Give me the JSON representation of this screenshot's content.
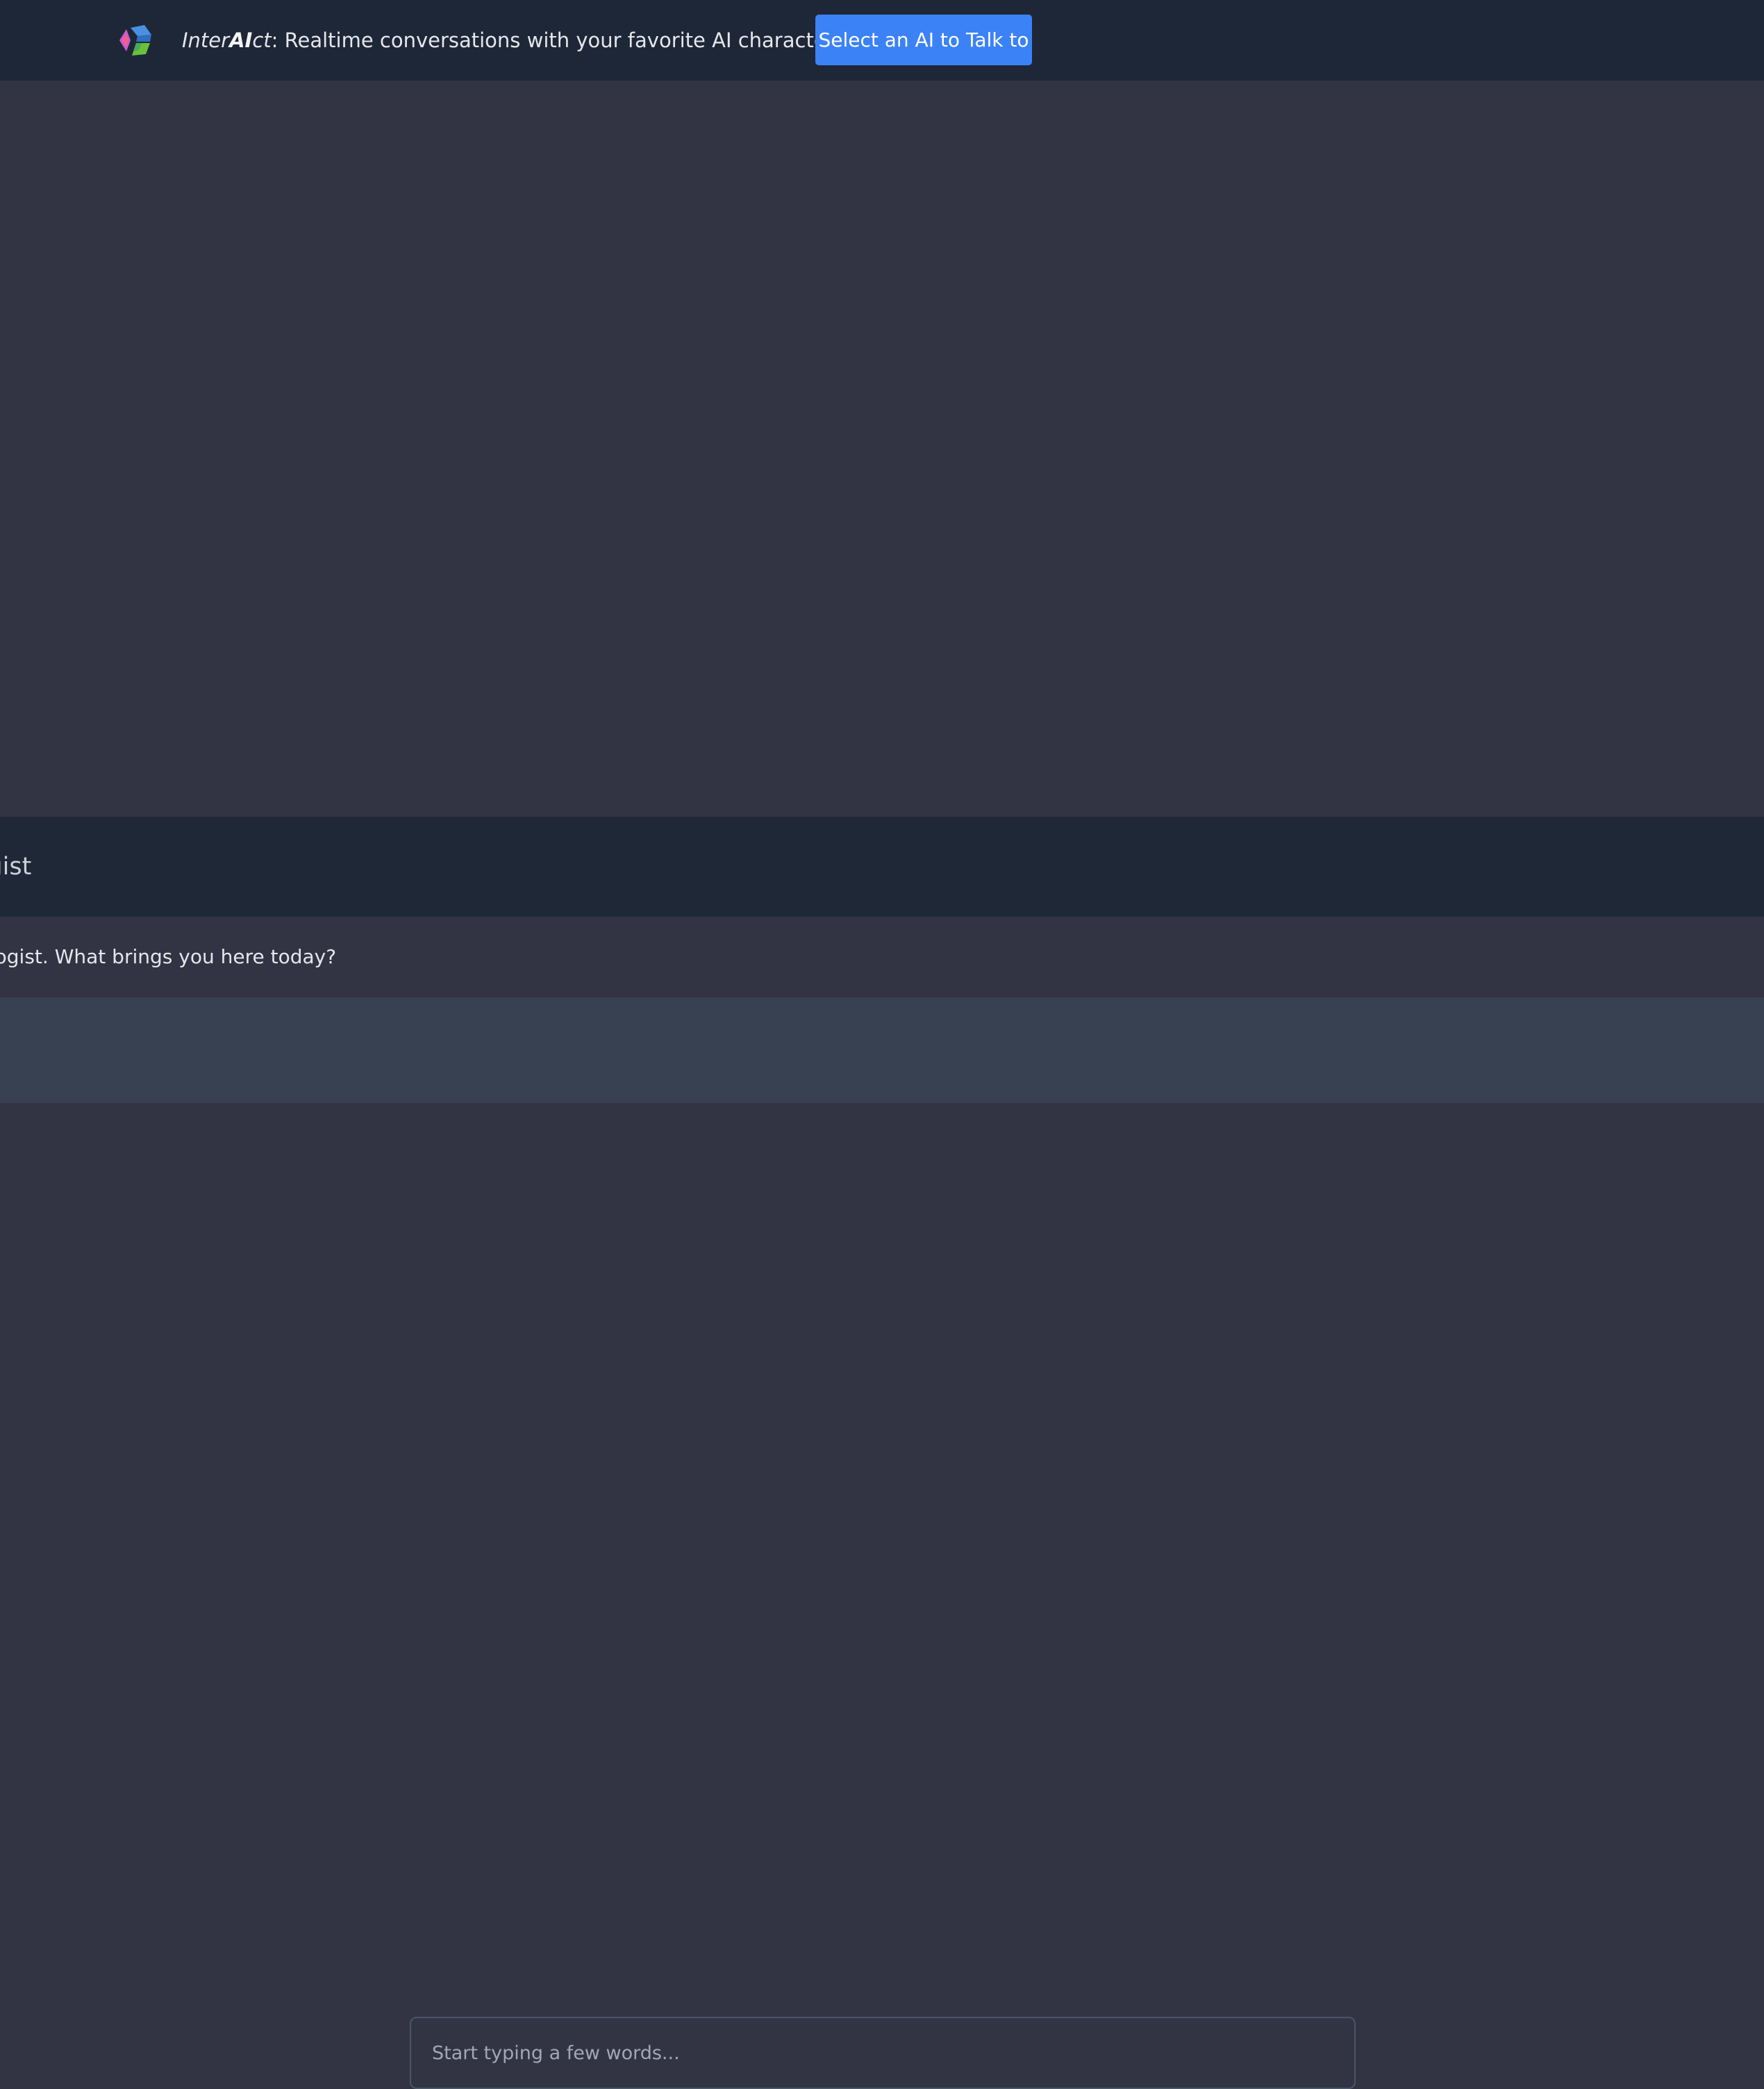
{
  "header": {
    "brand_prefix": "Inter",
    "brand_bold": "AI",
    "brand_suffix": "ct",
    "tagline": ": Realtime conversations with your favorite AI character",
    "select_button_label": "Select an AI to Talk to",
    "logo_icon": "hexagon-cube-logo-icon"
  },
  "character": {
    "name_partial": "ogist"
  },
  "conversation": {
    "messages": [
      {
        "text": "hologist. What brings you here today?"
      }
    ]
  },
  "composer": {
    "placeholder": "Start typing a few words..."
  },
  "colors": {
    "topbar_bg": "#1e2737",
    "stage_bg": "#323443",
    "accent": "#3b82f6",
    "input_area_bg": "#384152"
  }
}
